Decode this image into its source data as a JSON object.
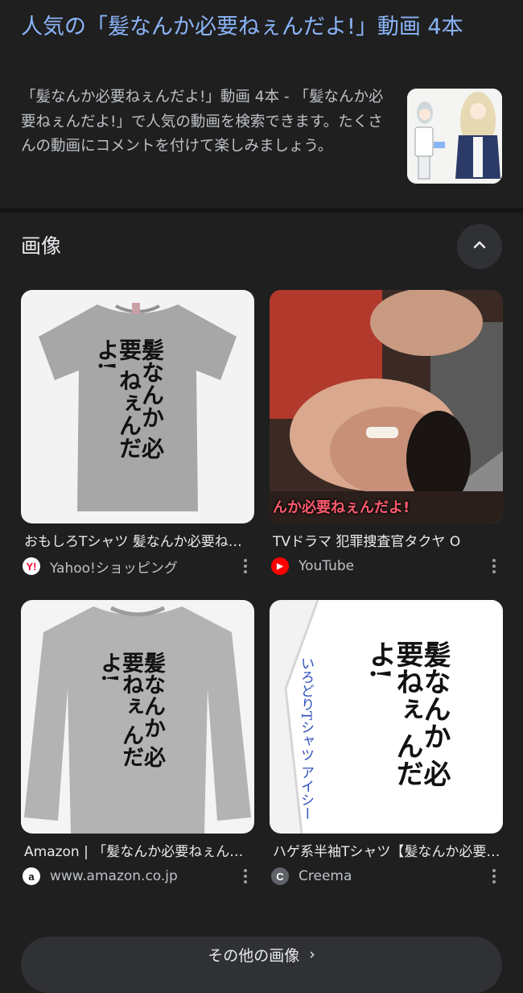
{
  "result": {
    "title": "人気の「髪なんか必要ねぇんだよ!」動画 4本",
    "snippet": "「髪なんか必要ねぇんだよ!」動画 4本 - 「髪なんか必要ねぇんだよ!」で人気の動画を検索できます。たくさんの動画にコメントを付けて楽しみましょう。"
  },
  "images_section": {
    "header": "画像",
    "collapse_icon": "chevron-up-icon",
    "cards": [
      {
        "title": "おもしろTシャツ 髪なんか必要ねぇんだよ!",
        "source": "Yahoo!ショッピング",
        "favicon_text": "Y!",
        "favicon_bg": "#ffffff",
        "favicon_fg": "#ff0033",
        "print_text": "髪なんか 必要 ねぇんだよ!"
      },
      {
        "title": "TVドラマ 犯罪捜査官タクヤ O",
        "source": "YouTube",
        "favicon_text": "▶",
        "favicon_bg": "#ff0000",
        "favicon_fg": "#ffffff",
        "caption_text": "んか必要ねぇんだよ!"
      },
      {
        "title": "Amazon | 「髪なんか必要ねぇんだよ!」",
        "source": "www.amazon.co.jp",
        "favicon_text": "a",
        "favicon_bg": "#ffffff",
        "favicon_fg": "#111111",
        "print_text": "髪なんか 必要ねぇ んだよ!"
      },
      {
        "title": "ハゲ系半袖Tシャツ【髪なんか必要ねぇんだよ!】",
        "source": "Creema",
        "favicon_text": "C",
        "favicon_bg": "#5f6368",
        "favicon_fg": "#ffffff",
        "print_text": "髪なんか 必要ねぇ んだよ!",
        "side_text": "いろどりTシャツ アイシー"
      }
    ],
    "more_images_label": "その他の画像",
    "more_images_icon": "arrow-right-icon"
  },
  "colors": {
    "background": "#1f1f1f",
    "link": "#8ab4f8",
    "text_secondary": "#bdc1c6"
  }
}
